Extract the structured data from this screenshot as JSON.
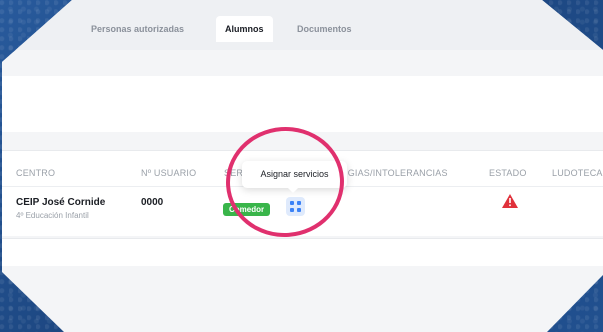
{
  "tabs": {
    "items": [
      {
        "label": "Personas autorizadas"
      },
      {
        "label": "Alumnos"
      },
      {
        "label": "Documentos"
      }
    ],
    "active": "Alumnos"
  },
  "table": {
    "headers": {
      "centro": "CENTRO",
      "usuario": "Nº USUARIO",
      "servicios": "SER",
      "alergias": "RGIAS/INTOLERANCIAS",
      "estado": "ESTADO",
      "ludoteca": "LUDOTECA"
    },
    "rows": [
      {
        "centro": "CEIP José Cornide",
        "curso": "4º Educación Infantil",
        "usuario": "0000",
        "servicio_badge": "Comedor",
        "estado_icon": "warning-triangle-icon"
      }
    ]
  },
  "tooltip": {
    "text": "Asignar servicios"
  },
  "colors": {
    "badge_green": "#39b54a",
    "warning_red": "#e0313b",
    "highlight_ring": "#e0306e",
    "grid_button_bg": "#dfeafc"
  }
}
